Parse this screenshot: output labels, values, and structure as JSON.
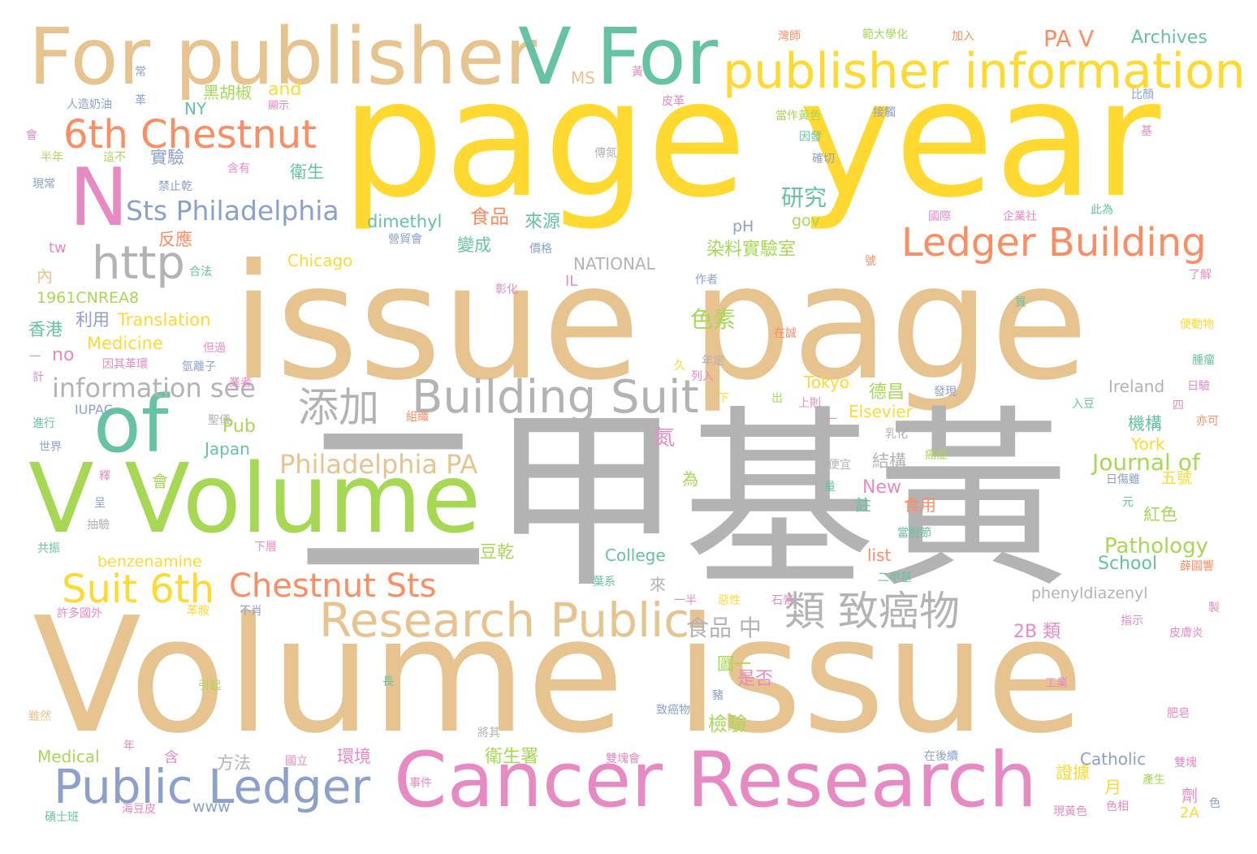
{
  "palette": {
    "tan": "#e6c38f",
    "yellow": "#ffd92f",
    "gray": "#b3b3b3",
    "green": "#66c2a5",
    "lime": "#a6d854",
    "pink": "#e78ac3",
    "blue": "#8da0cb",
    "orange": "#fc8d62"
  },
  "words": [
    {
      "text": "Volume issue",
      "color": "tan"
    },
    {
      "text": "issue page",
      "color": "tan"
    },
    {
      "text": "page year",
      "color": "yellow"
    },
    {
      "text": "二甲基黃",
      "color": "gray"
    },
    {
      "text": "V Volume",
      "color": "lime"
    },
    {
      "text": "For publisher",
      "color": "tan"
    },
    {
      "text": "Cancer Research",
      "color": "pink"
    },
    {
      "text": "V For",
      "color": "green"
    },
    {
      "text": "publisher information",
      "color": "yellow"
    },
    {
      "text": "N",
      "color": "pink"
    },
    {
      "text": "of",
      "color": "green"
    },
    {
      "text": "Research Public",
      "color": "tan"
    },
    {
      "text": "Public Ledger",
      "color": "blue"
    },
    {
      "text": "Building Suit",
      "color": "gray"
    },
    {
      "text": "Ledger Building",
      "color": "orange"
    },
    {
      "text": "6th Chestnut",
      "color": "orange"
    },
    {
      "text": "Suit 6th",
      "color": "yellow"
    },
    {
      "text": "Chestnut Sts",
      "color": "orange"
    },
    {
      "text": "http",
      "color": "gray"
    },
    {
      "text": "類 致癌物",
      "color": "gray"
    },
    {
      "text": "添加",
      "color": "gray"
    },
    {
      "text": "Philadelphia PA",
      "color": "tan"
    },
    {
      "text": "Sts Philadelphia",
      "color": "blue"
    },
    {
      "text": "information see",
      "color": "gray"
    },
    {
      "text": "PA V",
      "color": "orange"
    },
    {
      "text": "Archives",
      "color": "green"
    },
    {
      "text": "食品 中",
      "color": "gray"
    },
    {
      "text": "研究",
      "color": "green"
    },
    {
      "text": "Journal of",
      "color": "lime"
    },
    {
      "text": "Pathology",
      "color": "lime"
    },
    {
      "text": "School",
      "color": "green"
    },
    {
      "text": "色素",
      "color": "lime"
    },
    {
      "text": "Translation",
      "color": "yellow"
    },
    {
      "text": "Medicine",
      "color": "yellow"
    },
    {
      "text": "Chicago",
      "color": "yellow"
    },
    {
      "text": "dimethyl",
      "color": "green"
    },
    {
      "text": "NATIONAL",
      "color": "gray"
    },
    {
      "text": "benzenamine",
      "color": "yellow"
    },
    {
      "text": "phenyldiazenyl",
      "color": "gray"
    },
    {
      "text": "College",
      "color": "green"
    },
    {
      "text": "Catholic",
      "color": "blue"
    },
    {
      "text": "Medical",
      "color": "lime"
    },
    {
      "text": "Elsevier",
      "color": "yellow"
    },
    {
      "text": "Ireland",
      "color": "gray"
    },
    {
      "text": "Tokyo",
      "color": "yellow"
    },
    {
      "text": "Japan",
      "color": "green"
    },
    {
      "text": "New",
      "color": "pink"
    },
    {
      "text": "York",
      "color": "yellow"
    },
    {
      "text": "Pub",
      "color": "lime"
    },
    {
      "text": "and",
      "color": "yellow"
    },
    {
      "text": "MS",
      "color": "tan"
    },
    {
      "text": "NY",
      "color": "green"
    },
    {
      "text": "no",
      "color": "pink"
    },
    {
      "text": "list",
      "color": "orange"
    },
    {
      "text": "www",
      "color": "blue"
    },
    {
      "text": "2B 類",
      "color": "pink"
    },
    {
      "text": "2A",
      "color": "yellow"
    },
    {
      "text": "pH",
      "color": "blue"
    },
    {
      "text": "gov",
      "color": "lime"
    },
    {
      "text": "IL",
      "color": "pink"
    },
    {
      "text": "tw",
      "color": "pink"
    },
    {
      "text": "IUPAC",
      "color": "blue"
    },
    {
      "text": "1961CNREA8",
      "color": "lime"
    },
    {
      "text": "黑胡椒",
      "color": "lime"
    },
    {
      "text": "實驗",
      "color": "blue"
    },
    {
      "text": "衛生",
      "color": "green"
    },
    {
      "text": "食品",
      "color": "orange"
    },
    {
      "text": "來源",
      "color": "green"
    },
    {
      "text": "變成",
      "color": "green"
    },
    {
      "text": "染料實驗室",
      "color": "lime"
    },
    {
      "text": "反應",
      "color": "orange"
    },
    {
      "text": "香港",
      "color": "green"
    },
    {
      "text": "利用",
      "color": "blue"
    },
    {
      "text": "檢驗",
      "color": "lime"
    },
    {
      "text": "衛生署",
      "color": "lime"
    },
    {
      "text": "環境",
      "color": "pink"
    },
    {
      "text": "方法",
      "color": "gray"
    },
    {
      "text": "德昌",
      "color": "lime"
    },
    {
      "text": "機構",
      "color": "green"
    },
    {
      "text": "紅色",
      "color": "lime"
    },
    {
      "text": "五號",
      "color": "yellow"
    },
    {
      "text": "氮",
      "color": "pink"
    },
    {
      "text": "結構",
      "color": "gray"
    },
    {
      "text": "豆乾",
      "color": "lime"
    },
    {
      "text": "是否",
      "color": "pink"
    },
    {
      "text": "圖一",
      "color": "lime"
    },
    {
      "text": "證據",
      "color": "yellow"
    },
    {
      "text": "月",
      "color": "yellow"
    },
    {
      "text": "劑",
      "color": "pink"
    },
    {
      "text": "食用",
      "color": "orange"
    },
    {
      "text": "註",
      "color": "green"
    },
    {
      "text": "為",
      "color": "lime"
    },
    {
      "text": "來",
      "color": "gray"
    },
    {
      "text": "含",
      "color": "pink"
    },
    {
      "text": "會",
      "color": "lime"
    },
    {
      "text": "內",
      "color": "tan"
    },
    {
      "text": "灣師",
      "color": "orange"
    },
    {
      "text": "範大學化",
      "color": "lime"
    },
    {
      "text": "加入",
      "color": "orange"
    },
    {
      "text": "常",
      "color": "blue"
    },
    {
      "text": "黃",
      "color": "pink"
    },
    {
      "text": "革",
      "color": "blue"
    },
    {
      "text": "人造奶油",
      "color": "blue"
    },
    {
      "text": "皮革",
      "color": "pink"
    },
    {
      "text": "當作黃色",
      "color": "lime"
    },
    {
      "text": "接觸",
      "color": "blue"
    },
    {
      "text": "比顏",
      "color": "blue"
    },
    {
      "text": "會",
      "color": "pink"
    },
    {
      "text": "半年",
      "color": "lime"
    },
    {
      "text": "這不",
      "color": "lime"
    },
    {
      "text": "顯示",
      "color": "pink"
    },
    {
      "text": "傳氮",
      "color": "gray"
    },
    {
      "text": "因發",
      "color": "green"
    },
    {
      "text": "確切",
      "color": "blue"
    },
    {
      "text": "現常",
      "color": "blue"
    },
    {
      "text": "禁止乾",
      "color": "blue"
    },
    {
      "text": "含有",
      "color": "pink"
    },
    {
      "text": "國際",
      "color": "pink"
    },
    {
      "text": "企業社",
      "color": "pink"
    },
    {
      "text": "此為",
      "color": "green"
    },
    {
      "text": "價格",
      "color": "blue"
    },
    {
      "text": "營貿會",
      "color": "blue"
    },
    {
      "text": "合法",
      "color": "green"
    },
    {
      "text": "彰化",
      "color": "pink"
    },
    {
      "text": "作者",
      "color": "blue"
    },
    {
      "text": "號",
      "color": "orange"
    },
    {
      "text": "了解",
      "color": "pink"
    },
    {
      "text": "質",
      "color": "green"
    },
    {
      "text": "便動物",
      "color": "yellow"
    },
    {
      "text": "在誠",
      "color": "orange"
    },
    {
      "text": "但過",
      "color": "pink"
    },
    {
      "text": "因其革環",
      "color": "pink"
    },
    {
      "text": "氫離子",
      "color": "blue"
    },
    {
      "text": "久",
      "color": "yellow"
    },
    {
      "text": "年定",
      "color": "gray"
    },
    {
      "text": "列入",
      "color": "pink"
    },
    {
      "text": "腫瘤",
      "color": "green"
    },
    {
      "text": "日驗",
      "color": "pink"
    },
    {
      "text": "計",
      "color": "pink"
    },
    {
      "text": "下",
      "color": "yellow"
    },
    {
      "text": "出",
      "color": "lime"
    },
    {
      "text": "上則",
      "color": "pink"
    },
    {
      "text": "發現",
      "color": "blue"
    },
    {
      "text": "入豆",
      "color": "green"
    },
    {
      "text": "四",
      "color": "pink"
    },
    {
      "text": "亦可",
      "color": "orange"
    },
    {
      "text": "進行",
      "color": "green"
    },
    {
      "text": "聖儀",
      "color": "gray"
    },
    {
      "text": "組織",
      "color": "orange"
    },
    {
      "text": "乳化",
      "color": "gray"
    },
    {
      "text": "世界",
      "color": "blue"
    },
    {
      "text": "癌症",
      "color": "lime"
    },
    {
      "text": "便宜",
      "color": "gray"
    },
    {
      "text": "釋",
      "color": "pink"
    },
    {
      "text": "呈",
      "color": "blue"
    },
    {
      "text": "抽驗",
      "color": "gray"
    },
    {
      "text": "共振",
      "color": "green"
    },
    {
      "text": "下層",
      "color": "pink"
    },
    {
      "text": "量",
      "color": "green"
    },
    {
      "text": "日傷雖",
      "color": "blue"
    },
    {
      "text": "元",
      "color": "green"
    },
    {
      "text": "當脫節",
      "color": "green"
    },
    {
      "text": "葉系",
      "color": "green"
    },
    {
      "text": "二甲基",
      "color": "green"
    },
    {
      "text": "薛園響",
      "color": "orange"
    },
    {
      "text": "許多國外",
      "color": "pink"
    },
    {
      "text": "苯胺",
      "color": "yellow"
    },
    {
      "text": "不肖",
      "color": "blue"
    },
    {
      "text": "一半",
      "color": "pink"
    },
    {
      "text": "惡性",
      "color": "yellow"
    },
    {
      "text": "石膏",
      "color": "pink"
    },
    {
      "text": "製",
      "color": "pink"
    },
    {
      "text": "指示",
      "color": "pink"
    },
    {
      "text": "皮膚炎",
      "color": "pink"
    },
    {
      "text": "引起",
      "color": "lime"
    },
    {
      "text": "長",
      "color": "green"
    },
    {
      "text": "豬",
      "color": "blue"
    },
    {
      "text": "工業",
      "color": "pink"
    },
    {
      "text": "致癌物",
      "color": "blue"
    },
    {
      "text": "肥皂",
      "color": "pink"
    },
    {
      "text": "雖然",
      "color": "tan"
    },
    {
      "text": "將其",
      "color": "gray"
    },
    {
      "text": "年",
      "color": "pink"
    },
    {
      "text": "國立",
      "color": "pink"
    },
    {
      "text": "雙塊會",
      "color": "pink"
    },
    {
      "text": "在後續",
      "color": "blue"
    },
    {
      "text": "雙塊",
      "color": "pink"
    },
    {
      "text": "事件",
      "color": "pink"
    },
    {
      "text": "產生",
      "color": "lime"
    },
    {
      "text": "碩士班",
      "color": "green"
    },
    {
      "text": "海豆皮",
      "color": "pink"
    },
    {
      "text": "現黃色",
      "color": "pink"
    },
    {
      "text": "色相",
      "color": "pink"
    },
    {
      "text": "色",
      "color": "blue"
    },
    {
      "text": "一",
      "color": "pink"
    },
    {
      "text": "一",
      "color": "pink"
    },
    {
      "text": "業者",
      "color": "pink"
    },
    {
      "text": "基",
      "color": "pink"
    }
  ]
}
